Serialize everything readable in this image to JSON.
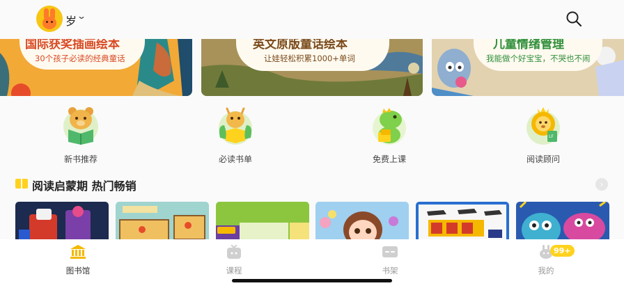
{
  "header": {
    "age_label": "岁",
    "avatar_icon": "bunny-avatar-icon",
    "dropdown_icon": "chevron-down-icon",
    "search_icon": "search-icon"
  },
  "banners": [
    {
      "title": "国际获奖插画绘本",
      "subtitle": "30个孩子必读的经典童话",
      "accent": "#d84a25"
    },
    {
      "title": "英文原版童话绘本",
      "subtitle": "让娃轻松积累1000+单词",
      "accent": "#7a4a1a"
    },
    {
      "title": "儿童情绪管理",
      "subtitle": "我能做个好宝宝，不哭也不闹",
      "accent": "#2f8f3a"
    }
  ],
  "categories": [
    {
      "label": "新书推荐",
      "icon": "bear-reading-icon"
    },
    {
      "label": "必读书单",
      "icon": "deer-reading-icon"
    },
    {
      "label": "免费上课",
      "icon": "dinosaur-icon"
    },
    {
      "label": "阅读顾问",
      "icon": "lion-icon"
    }
  ],
  "section": {
    "title": "阅读启蒙期 热门畅销",
    "icon": "open-book-icon",
    "more_icon": "chevron-right-icon"
  },
  "tabs": [
    {
      "label": "图书馆",
      "icon": "library-icon",
      "active": true
    },
    {
      "label": "课程",
      "icon": "tv-icon",
      "active": false
    },
    {
      "label": "书架",
      "icon": "bookshelf-icon",
      "active": false
    },
    {
      "label": "我的",
      "icon": "bunny-profile-icon",
      "active": false
    }
  ],
  "profile_badge": "99+",
  "colors": {
    "brand_yellow": "#ffd21e",
    "tab_active": "#f5b800",
    "tab_inactive": "#cfcfcf"
  }
}
